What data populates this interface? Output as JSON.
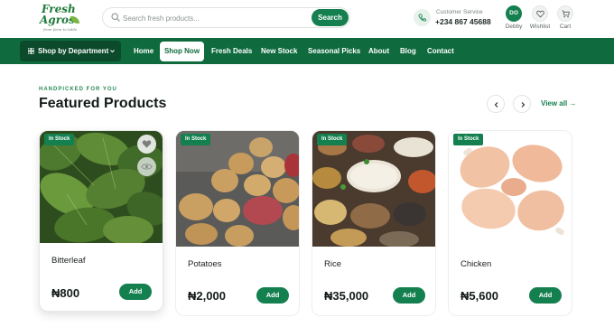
{
  "brand": {
    "line1": "Fresh",
    "line2": "Agros",
    "tagline": "from farm to table"
  },
  "search": {
    "placeholder": "Search fresh products...",
    "button": "Search"
  },
  "customer_service": {
    "label": "Customer Service",
    "phone": "+234 867 45688"
  },
  "header_actions": {
    "user_initials": "DO",
    "user_name": "Debby",
    "wishlist": "Wishlist",
    "cart": "Cart"
  },
  "nav": {
    "department_button": "Shop by Department",
    "links": [
      "Home",
      "Shop Now",
      "Fresh Deals",
      "New Stock",
      "Seasonal Picks",
      "About",
      "Blog",
      "Contact"
    ],
    "active": "Shop Now"
  },
  "section": {
    "eyebrow": "HANDPICKED FOR YOU",
    "title": "Featured Products",
    "view_all": "View all →"
  },
  "products": [
    {
      "name": "Bitterleaf",
      "price": "₦800",
      "badge": "In Stock",
      "add": "Add",
      "image_icon": "bitterleaf-photo"
    },
    {
      "name": "Potatoes",
      "price": "₦2,000",
      "badge": "In Stock",
      "add": "Add",
      "image_icon": "potatoes-photo"
    },
    {
      "name": "Rice",
      "price": "₦35,000",
      "badge": "In Stock",
      "add": "Add",
      "image_icon": "rice-photo"
    },
    {
      "name": "Chicken",
      "price": "₦5,600",
      "badge": "In Stock",
      "add": "Add",
      "image_icon": "chicken-photo"
    }
  ],
  "colors": {
    "brand_green": "#15804f",
    "nav_green": "#0f6b3e",
    "dept_green": "#0b4a2b"
  }
}
